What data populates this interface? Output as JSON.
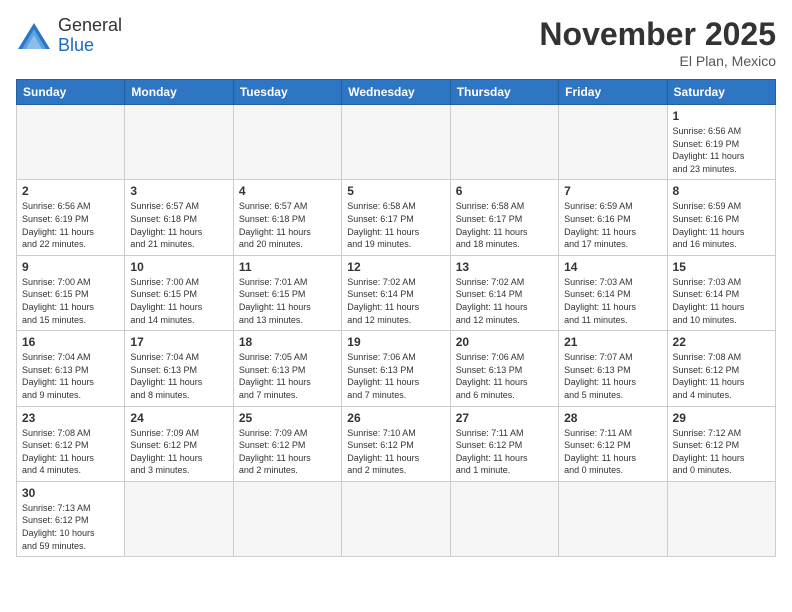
{
  "header": {
    "logo_general": "General",
    "logo_blue": "Blue",
    "month_title": "November 2025",
    "location": "El Plan, Mexico"
  },
  "days_of_week": [
    "Sunday",
    "Monday",
    "Tuesday",
    "Wednesday",
    "Thursday",
    "Friday",
    "Saturday"
  ],
  "weeks": [
    [
      {
        "day": "",
        "info": ""
      },
      {
        "day": "",
        "info": ""
      },
      {
        "day": "",
        "info": ""
      },
      {
        "day": "",
        "info": ""
      },
      {
        "day": "",
        "info": ""
      },
      {
        "day": "",
        "info": ""
      },
      {
        "day": "1",
        "info": "Sunrise: 6:56 AM\nSunset: 6:19 PM\nDaylight: 11 hours\nand 23 minutes."
      }
    ],
    [
      {
        "day": "2",
        "info": "Sunrise: 6:56 AM\nSunset: 6:19 PM\nDaylight: 11 hours\nand 22 minutes."
      },
      {
        "day": "3",
        "info": "Sunrise: 6:57 AM\nSunset: 6:18 PM\nDaylight: 11 hours\nand 21 minutes."
      },
      {
        "day": "4",
        "info": "Sunrise: 6:57 AM\nSunset: 6:18 PM\nDaylight: 11 hours\nand 20 minutes."
      },
      {
        "day": "5",
        "info": "Sunrise: 6:58 AM\nSunset: 6:17 PM\nDaylight: 11 hours\nand 19 minutes."
      },
      {
        "day": "6",
        "info": "Sunrise: 6:58 AM\nSunset: 6:17 PM\nDaylight: 11 hours\nand 18 minutes."
      },
      {
        "day": "7",
        "info": "Sunrise: 6:59 AM\nSunset: 6:16 PM\nDaylight: 11 hours\nand 17 minutes."
      },
      {
        "day": "8",
        "info": "Sunrise: 6:59 AM\nSunset: 6:16 PM\nDaylight: 11 hours\nand 16 minutes."
      }
    ],
    [
      {
        "day": "9",
        "info": "Sunrise: 7:00 AM\nSunset: 6:15 PM\nDaylight: 11 hours\nand 15 minutes."
      },
      {
        "day": "10",
        "info": "Sunrise: 7:00 AM\nSunset: 6:15 PM\nDaylight: 11 hours\nand 14 minutes."
      },
      {
        "day": "11",
        "info": "Sunrise: 7:01 AM\nSunset: 6:15 PM\nDaylight: 11 hours\nand 13 minutes."
      },
      {
        "day": "12",
        "info": "Sunrise: 7:02 AM\nSunset: 6:14 PM\nDaylight: 11 hours\nand 12 minutes."
      },
      {
        "day": "13",
        "info": "Sunrise: 7:02 AM\nSunset: 6:14 PM\nDaylight: 11 hours\nand 12 minutes."
      },
      {
        "day": "14",
        "info": "Sunrise: 7:03 AM\nSunset: 6:14 PM\nDaylight: 11 hours\nand 11 minutes."
      },
      {
        "day": "15",
        "info": "Sunrise: 7:03 AM\nSunset: 6:14 PM\nDaylight: 11 hours\nand 10 minutes."
      }
    ],
    [
      {
        "day": "16",
        "info": "Sunrise: 7:04 AM\nSunset: 6:13 PM\nDaylight: 11 hours\nand 9 minutes."
      },
      {
        "day": "17",
        "info": "Sunrise: 7:04 AM\nSunset: 6:13 PM\nDaylight: 11 hours\nand 8 minutes."
      },
      {
        "day": "18",
        "info": "Sunrise: 7:05 AM\nSunset: 6:13 PM\nDaylight: 11 hours\nand 7 minutes."
      },
      {
        "day": "19",
        "info": "Sunrise: 7:06 AM\nSunset: 6:13 PM\nDaylight: 11 hours\nand 7 minutes."
      },
      {
        "day": "20",
        "info": "Sunrise: 7:06 AM\nSunset: 6:13 PM\nDaylight: 11 hours\nand 6 minutes."
      },
      {
        "day": "21",
        "info": "Sunrise: 7:07 AM\nSunset: 6:13 PM\nDaylight: 11 hours\nand 5 minutes."
      },
      {
        "day": "22",
        "info": "Sunrise: 7:08 AM\nSunset: 6:12 PM\nDaylight: 11 hours\nand 4 minutes."
      }
    ],
    [
      {
        "day": "23",
        "info": "Sunrise: 7:08 AM\nSunset: 6:12 PM\nDaylight: 11 hours\nand 4 minutes."
      },
      {
        "day": "24",
        "info": "Sunrise: 7:09 AM\nSunset: 6:12 PM\nDaylight: 11 hours\nand 3 minutes."
      },
      {
        "day": "25",
        "info": "Sunrise: 7:09 AM\nSunset: 6:12 PM\nDaylight: 11 hours\nand 2 minutes."
      },
      {
        "day": "26",
        "info": "Sunrise: 7:10 AM\nSunset: 6:12 PM\nDaylight: 11 hours\nand 2 minutes."
      },
      {
        "day": "27",
        "info": "Sunrise: 7:11 AM\nSunset: 6:12 PM\nDaylight: 11 hours\nand 1 minute."
      },
      {
        "day": "28",
        "info": "Sunrise: 7:11 AM\nSunset: 6:12 PM\nDaylight: 11 hours\nand 0 minutes."
      },
      {
        "day": "29",
        "info": "Sunrise: 7:12 AM\nSunset: 6:12 PM\nDaylight: 11 hours\nand 0 minutes."
      }
    ],
    [
      {
        "day": "30",
        "info": "Sunrise: 7:13 AM\nSunset: 6:12 PM\nDaylight: 10 hours\nand 59 minutes."
      },
      {
        "day": "",
        "info": ""
      },
      {
        "day": "",
        "info": ""
      },
      {
        "day": "",
        "info": ""
      },
      {
        "day": "",
        "info": ""
      },
      {
        "day": "",
        "info": ""
      },
      {
        "day": "",
        "info": ""
      }
    ]
  ]
}
